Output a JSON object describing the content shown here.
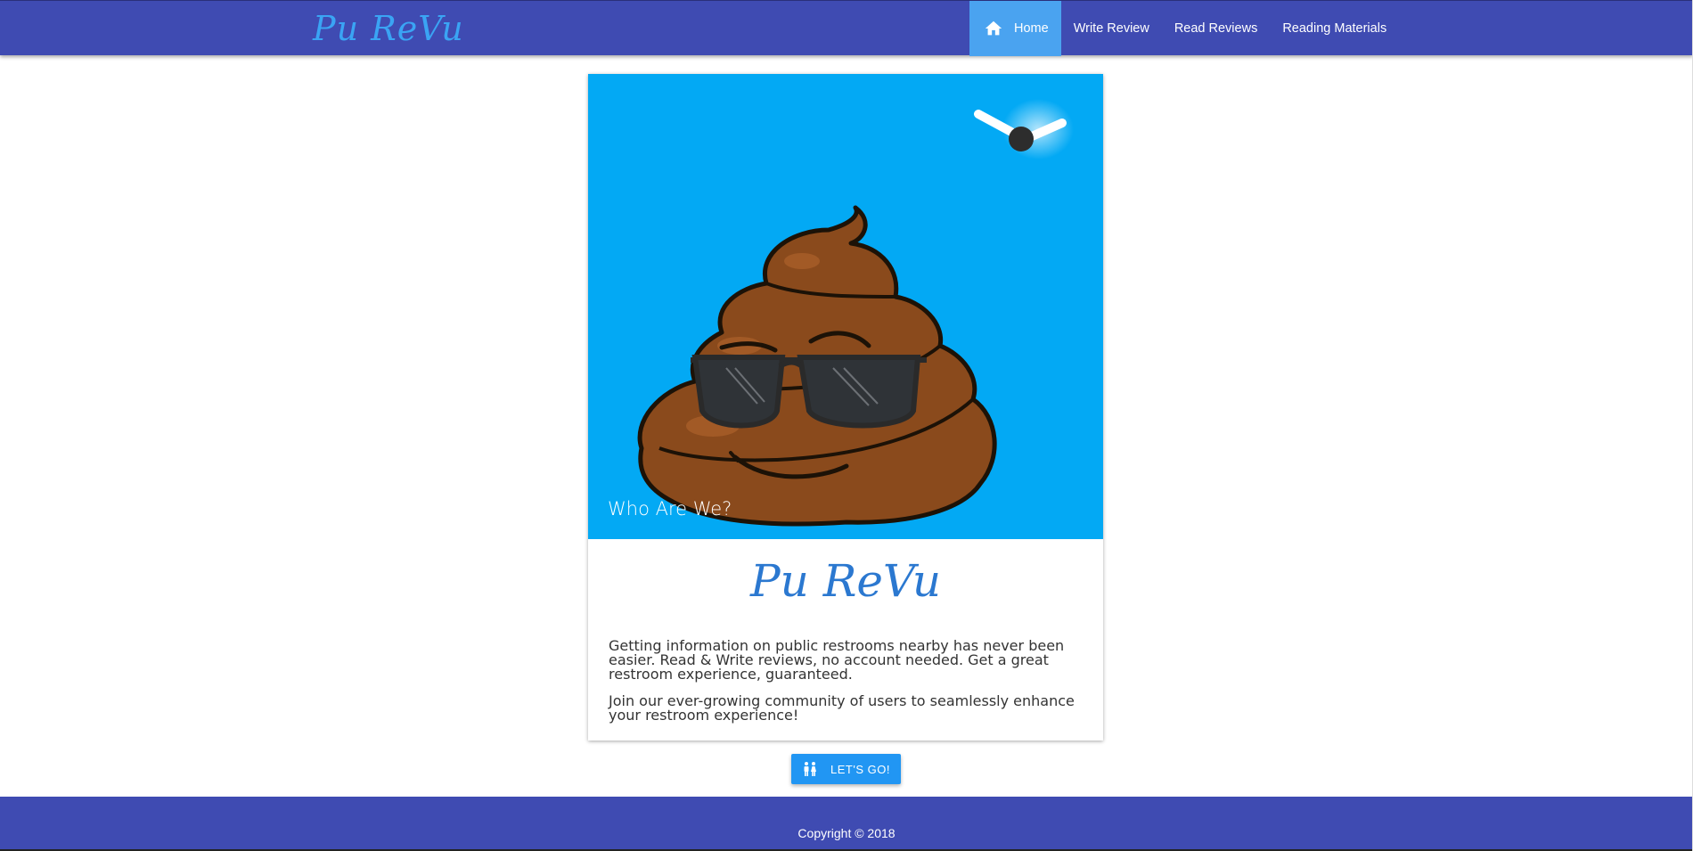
{
  "brand": "Pu ReVu",
  "nav": {
    "items": [
      {
        "label": "Home",
        "icon": "home-icon",
        "active": true
      },
      {
        "label": "Write Review",
        "active": false
      },
      {
        "label": "Read Reviews",
        "active": false
      },
      {
        "label": "Reading Materials",
        "active": false
      }
    ]
  },
  "card": {
    "hero_caption": "Who Are We?",
    "title": "Pu ReVu",
    "paragraphs": [
      "Getting information on public restrooms nearby has never been easier. Read & Write reviews, no account needed. Get a great restroom experience, guaranteed.",
      "Join our ever-growing community of users to seamlessly enhance your restroom experience!"
    ]
  },
  "cta": {
    "label": "LET'S GO!",
    "icon": "restroom-icon"
  },
  "footer": {
    "text": "Copyright © 2018"
  },
  "colors": {
    "navbar": "#3f4bb2",
    "nav_active": "#4aa3f0",
    "hero_bg": "#03a9f4",
    "brand_text": "#3aa4f4",
    "title_text": "#2b78d0",
    "button": "#2196f3"
  }
}
